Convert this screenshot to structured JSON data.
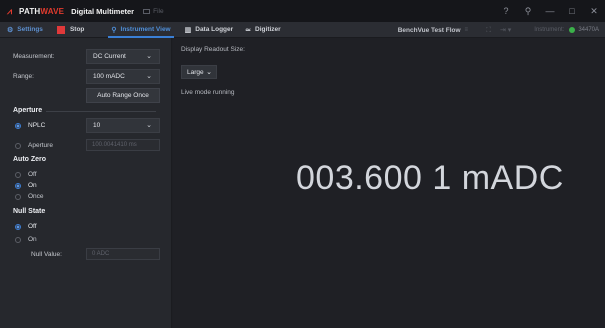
{
  "titlebar": {
    "brand_primary": "PATH",
    "brand_accent": "WAVE",
    "app_title": "Digital Multimeter",
    "file_label": "File",
    "controls": {
      "help": "?",
      "account": "⚲",
      "minimize": "—",
      "maximize": "□",
      "close": "✕"
    }
  },
  "toolbar": {
    "settings_label": "Settings",
    "stop_label": "Stop",
    "instrument_view_label": "Instrument View",
    "data_logger_label": "Data Logger",
    "digitizer_label": "Digitizer",
    "benchvue_label": "BenchVue Test Flow",
    "benchvue_badge": "≡",
    "instrument_label": "Instrument:",
    "instrument_name": "34470A"
  },
  "settings": {
    "measurement_label": "Measurement:",
    "measurement_value": "DC Current",
    "range_label": "Range:",
    "range_value": "100 mADC",
    "auto_range_button": "Auto Range Once",
    "aperture_heading": "Aperture",
    "nplc_label": "NPLC",
    "nplc_value": "10",
    "aperture_label": "Aperture",
    "aperture_value": "100.0041410 ms",
    "auto_zero_heading": "Auto Zero",
    "auto_zero_off": "Off",
    "auto_zero_on": "On",
    "auto_zero_once": "Once",
    "null_state_heading": "Null State",
    "null_off": "Off",
    "null_on": "On",
    "null_value_label": "Null Value:",
    "null_value": "0 ADC"
  },
  "display": {
    "readout_size_label": "Display Readout Size:",
    "readout_size_value": "Large",
    "live_status": "Live mode running",
    "reading": "003.600 1 mADC"
  },
  "colors": {
    "accent_blue": "#3a7fd5",
    "stop_red": "#e0393a",
    "brand_red": "#e23b2e",
    "connected_green": "#3bb14a"
  }
}
